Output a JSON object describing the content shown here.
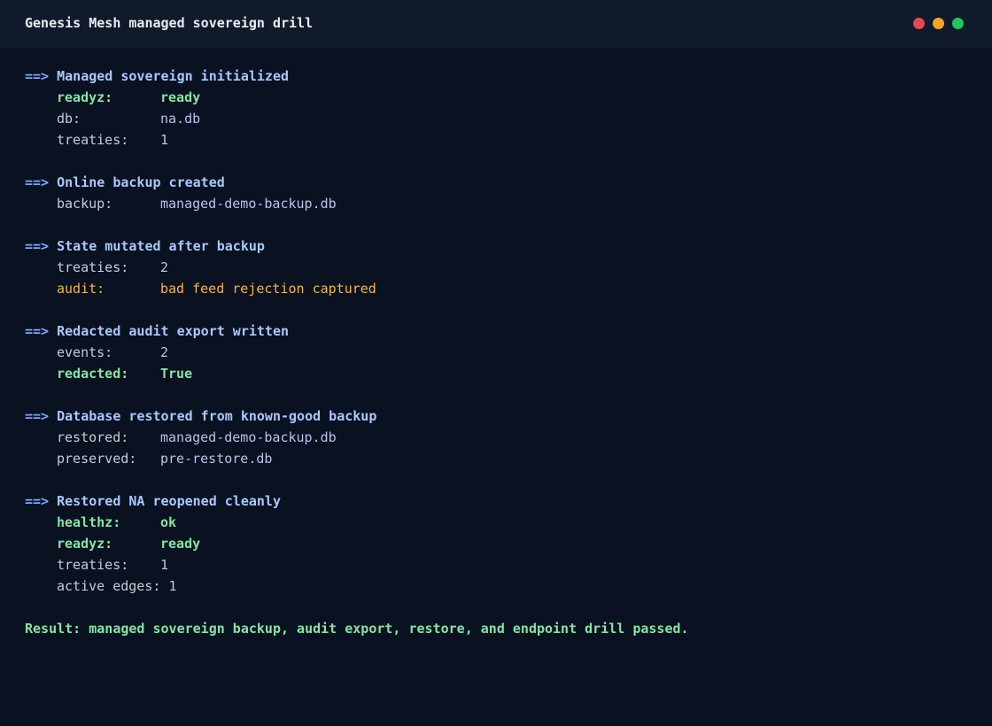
{
  "window": {
    "title": "Genesis Mesh managed sovereign drill",
    "controls": [
      {
        "name": "close",
        "color": "#e5484d"
      },
      {
        "name": "minimize",
        "color": "#f5a524"
      },
      {
        "name": "maximize",
        "color": "#22c55e"
      }
    ]
  },
  "colors": {
    "arrow": "#7aa7ff",
    "heading": "#a9c8ff",
    "text": "#c6ccd6",
    "value": "#b9c3e8",
    "success": "#86e3a2",
    "warning": "#f4b63f",
    "result": "#86e3a2"
  },
  "sections": [
    {
      "arrow": "==>",
      "heading": "Managed sovereign initialized",
      "rows": [
        {
          "key": "readyz:",
          "value": "ready",
          "tone": "success"
        },
        {
          "key": "db:",
          "value": "na.db",
          "tone": "plain"
        },
        {
          "key": "treaties:",
          "value": "1",
          "tone": "plain"
        }
      ]
    },
    {
      "arrow": "==>",
      "heading": "Online backup created",
      "rows": [
        {
          "key": "backup:",
          "value": "managed-demo-backup.db",
          "tone": "plain"
        }
      ]
    },
    {
      "arrow": "==>",
      "heading": "State mutated after backup",
      "rows": [
        {
          "key": "treaties:",
          "value": "2",
          "tone": "plain"
        },
        {
          "key": "audit:",
          "value": "bad feed rejection captured",
          "tone": "warning"
        }
      ]
    },
    {
      "arrow": "==>",
      "heading": "Redacted audit export written",
      "rows": [
        {
          "key": "events:",
          "value": "2",
          "tone": "plain"
        },
        {
          "key": "redacted:",
          "value": "True",
          "tone": "success"
        }
      ]
    },
    {
      "arrow": "==>",
      "heading": "Database restored from known-good backup",
      "rows": [
        {
          "key": "restored:",
          "value": "managed-demo-backup.db",
          "tone": "plain"
        },
        {
          "key": "preserved:",
          "value": "pre-restore.db",
          "tone": "plain"
        }
      ]
    },
    {
      "arrow": "==>",
      "heading": "Restored NA reopened cleanly",
      "rows": [
        {
          "key": "healthz:",
          "value": "ok",
          "tone": "success"
        },
        {
          "key": "readyz:",
          "value": "ready",
          "tone": "success"
        },
        {
          "key": "treaties:",
          "value": "1",
          "tone": "plain"
        },
        {
          "key": "active edges:",
          "value": "1",
          "tone": "plain",
          "wide": true
        }
      ]
    }
  ],
  "result": "Result: managed sovereign backup, audit export, restore, and endpoint drill passed."
}
